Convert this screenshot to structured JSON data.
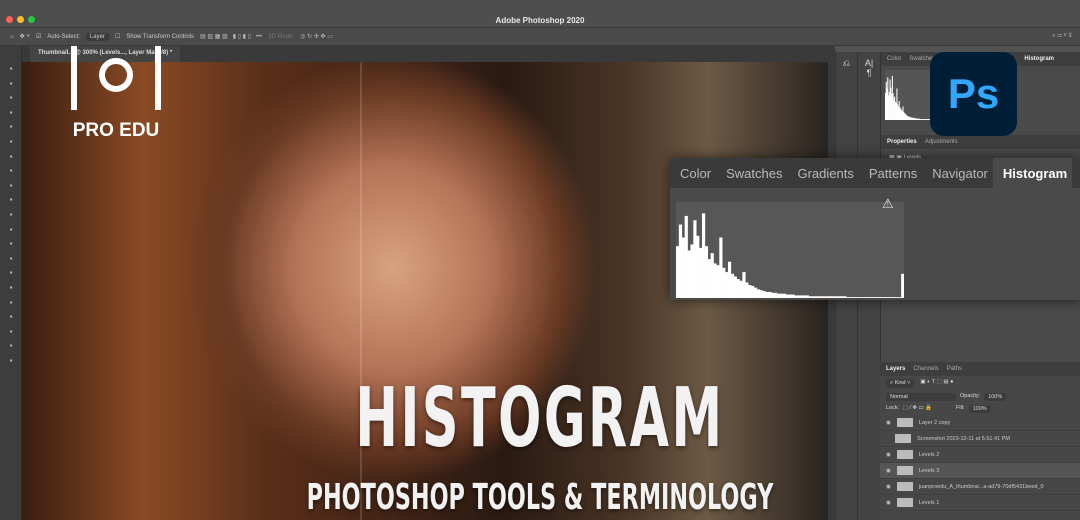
{
  "app_title": "Adobe Photoshop 2020",
  "options": {
    "auto_select_label": "Auto-Select:",
    "auto_select_value": "Layer",
    "show_transform": "Show Transform Controls",
    "mode_3d": "3D Mode:"
  },
  "doc_tab": "Thumbnail... @ 300% (Levels..., Layer Mask/8) *",
  "small_panel": {
    "tabs": [
      "Color",
      "Swatches",
      "Histogram"
    ]
  },
  "properties": {
    "tabs": [
      "Properties",
      "Adjustments"
    ],
    "item": "Levels"
  },
  "layers_panel": {
    "tabs": [
      "Layers",
      "Channels",
      "Paths"
    ],
    "filter": "Kind",
    "blend": "Normal",
    "opacity_label": "Opacity:",
    "opacity": "100%",
    "lock_label": "Lock:",
    "fill_label": "Fill:",
    "fill": "100%",
    "rows": [
      "Layer 2 copy",
      "Screenshot 2023-12-11 at 5.51.41 PM",
      "Levels 2",
      "Levels 3",
      "juanproedu_A_thumbnai...a-ad79-70df5431beed_0",
      "Levels 1"
    ]
  },
  "histogram_panel": {
    "tabs": [
      "Color",
      "Swatches",
      "Gradients",
      "Patterns",
      "Navigator",
      "Histogram"
    ],
    "active": "Histogram",
    "levels": [
      60,
      85,
      70,
      95,
      55,
      62,
      90,
      72,
      58,
      98,
      60,
      45,
      52,
      40,
      38,
      70,
      35,
      30,
      42,
      28,
      25,
      22,
      20,
      30,
      18,
      15,
      14,
      12,
      10,
      9,
      8,
      7,
      7,
      6,
      6,
      5,
      5,
      5,
      4,
      4,
      4,
      3,
      3,
      3,
      3,
      3,
      2,
      2,
      2,
      2,
      2,
      2,
      2,
      2,
      2,
      2,
      2,
      2,
      2,
      1,
      1,
      1,
      1,
      1,
      1,
      1,
      1,
      1,
      1,
      1,
      1,
      1,
      1,
      1,
      1,
      1,
      1,
      1,
      28
    ]
  },
  "ps_logo": "Ps",
  "brand": "PRO EDU",
  "headline": "HISTOGRAM",
  "subheadline": "PHOTOSHOP TOOLS & TERMINOLOGY"
}
